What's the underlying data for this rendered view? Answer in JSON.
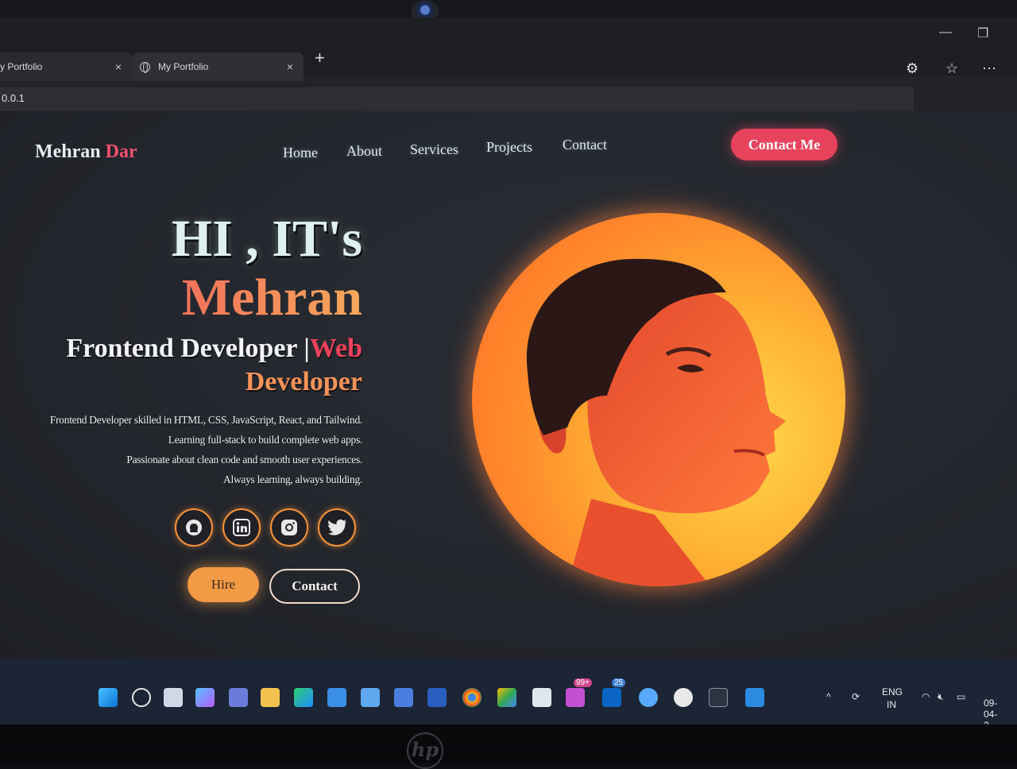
{
  "browser": {
    "tabs": [
      {
        "title": "y Portfolio"
      },
      {
        "title": "My Portfolio"
      }
    ],
    "address": "0.0.1"
  },
  "site": {
    "logo_first": "Mehran",
    "logo_second": "Dar",
    "nav": [
      "Home",
      "About",
      "Services",
      "Projects",
      "Contact"
    ],
    "cta": "Contact Me"
  },
  "hero": {
    "greeting": "HI , IT's",
    "name": "Mehran",
    "role_main": "Frontend Developer |",
    "role_web": "Web",
    "role_dev": "Developer",
    "bio": [
      "Frontend Developer skilled in HTML, CSS, JavaScript, React, and Tailwind.",
      "Learning full-stack to build complete web apps.",
      "Passionate about clean code and smooth user experiences.",
      "Always learning, always building."
    ],
    "social_icons": [
      "github-icon",
      "linkedin-icon",
      "instagram-icon",
      "twitter-icon"
    ],
    "hire_label": "Hire",
    "contact_label": "Contact"
  },
  "taskbar": {
    "badge_1": "99+",
    "badge_2": "25",
    "lang_top": "ENG",
    "lang_bottom": "IN",
    "date": "09-04-2"
  },
  "colors": {
    "accent_pink": "#f2506f",
    "accent_orange": "#f39a45",
    "page_bg": "#24272e"
  }
}
